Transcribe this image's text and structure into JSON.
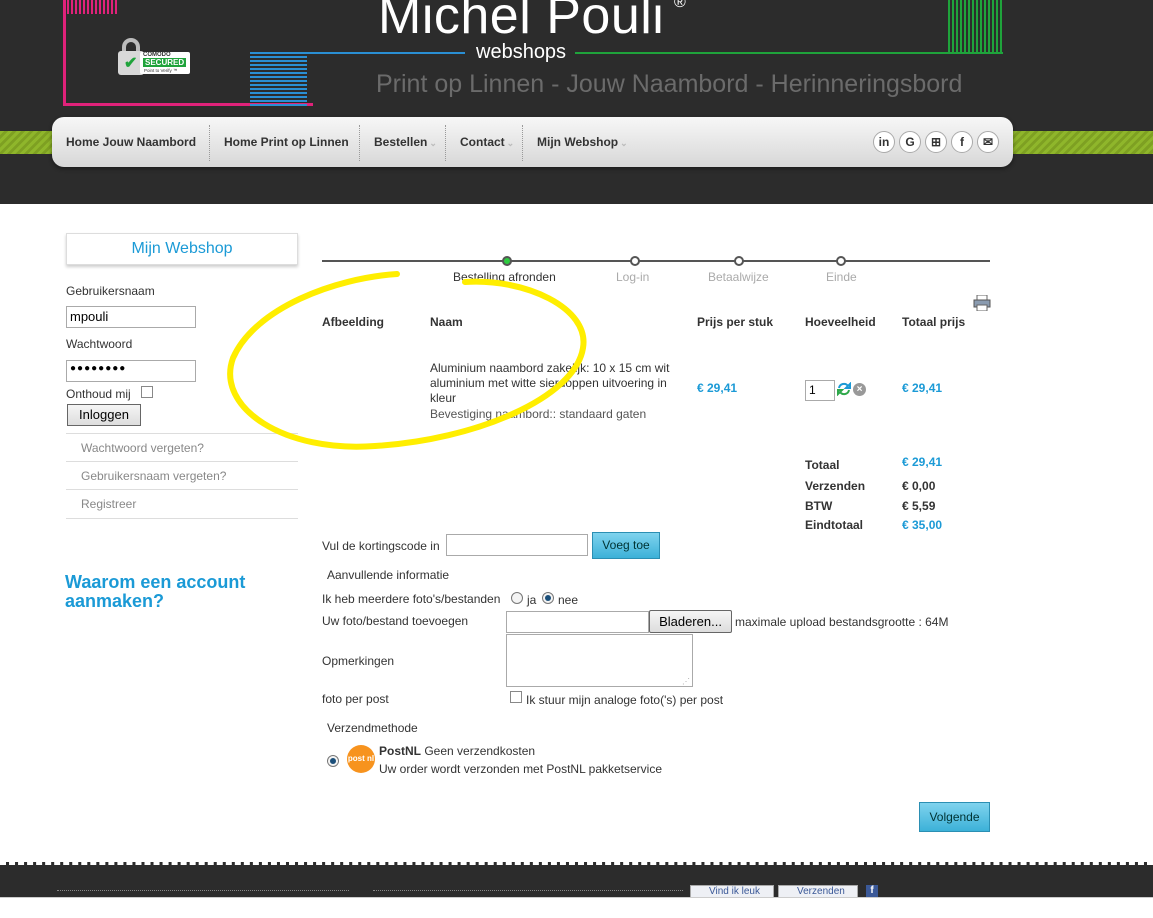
{
  "header": {
    "logo_title": "Michel Pouli",
    "logo_registered": "®",
    "logo_subtitle": "webshops",
    "tagline": "Print op Linnen - Jouw Naambord - Herinneringsbord",
    "badge": {
      "line1": "COMODO",
      "line2": "SECURED",
      "line3": "Point to Verify ™"
    }
  },
  "nav": {
    "items": [
      {
        "label": "Home Jouw Naambord"
      },
      {
        "label": "Home Print op Linnen"
      },
      {
        "label": "Bestellen",
        "caret": "⌄"
      },
      {
        "label": "Contact",
        "caret": "⌄"
      },
      {
        "label": "Mijn Webshop",
        "caret": "⌄"
      }
    ],
    "social": [
      "in",
      "G",
      "⊞",
      "f",
      "✉"
    ]
  },
  "sidebar": {
    "title": "Mijn Webshop",
    "username_label": "Gebruikersnaam",
    "username_value": "mpouli",
    "password_label": "Wachtwoord",
    "password_value": "●●●●●●●●",
    "remember_label": "Onthoud mij",
    "login_button": "Inloggen",
    "links": [
      "Wachtwoord vergeten?",
      "Gebruikersnaam vergeten?",
      "Registreer"
    ],
    "why_account": "Waarom een account aanmaken?"
  },
  "steps": [
    "Bestelling afronden",
    "Log-in",
    "Betaalwijze",
    "Einde"
  ],
  "table": {
    "headers": [
      "Afbeelding",
      "Naam",
      "Prijs per stuk",
      "Hoeveelheid",
      "Totaal prijs"
    ],
    "row": {
      "name": "Aluminium naambord zakelijk: 10 x 15 cm wit aluminium met witte sierdoppen uitvoering in kleur",
      "option": "Bevestiging naambord:: standaard gaten",
      "unit_price": "€ 29,41",
      "quantity": "1",
      "total": "€ 29,41"
    }
  },
  "summary": {
    "totaal_label": "Totaal",
    "totaal": "€ 29,41",
    "verzenden_label": "Verzenden",
    "verzenden": "€ 0,00",
    "btw_label": "BTW",
    "btw": "€ 5,59",
    "eind_label": "Eindtotaal",
    "eind": "€ 35,00"
  },
  "form": {
    "coupon_label": "Vul de kortingscode in",
    "coupon_button": "Voeg toe",
    "extra_info": "Aanvullende informatie",
    "multiple_photos_label": "Ik heb meerdere foto's/bestanden",
    "ja": "ja",
    "nee": "nee",
    "upload_label": "Uw foto/bestand toevoegen",
    "browse_button": "Bladeren...",
    "max_upload": "maximale upload bestandsgrootte : 64M",
    "remarks_label": "Opmerkingen",
    "post_label": "foto per post",
    "post_checkbox": "Ik stuur mijn analoge foto('s) per post",
    "shipping_title": "Verzendmethode",
    "shipping_name": "PostNL",
    "shipping_cost": "Geen verzendkosten",
    "shipping_desc": "Uw order wordt verzonden met PostNL pakketservice",
    "postnl_logo": "post nl",
    "next_button": "Volgende"
  },
  "footer": {
    "like": "Vind ik leuk",
    "send": "Verzenden"
  },
  "annotation_color": "#ffee00"
}
